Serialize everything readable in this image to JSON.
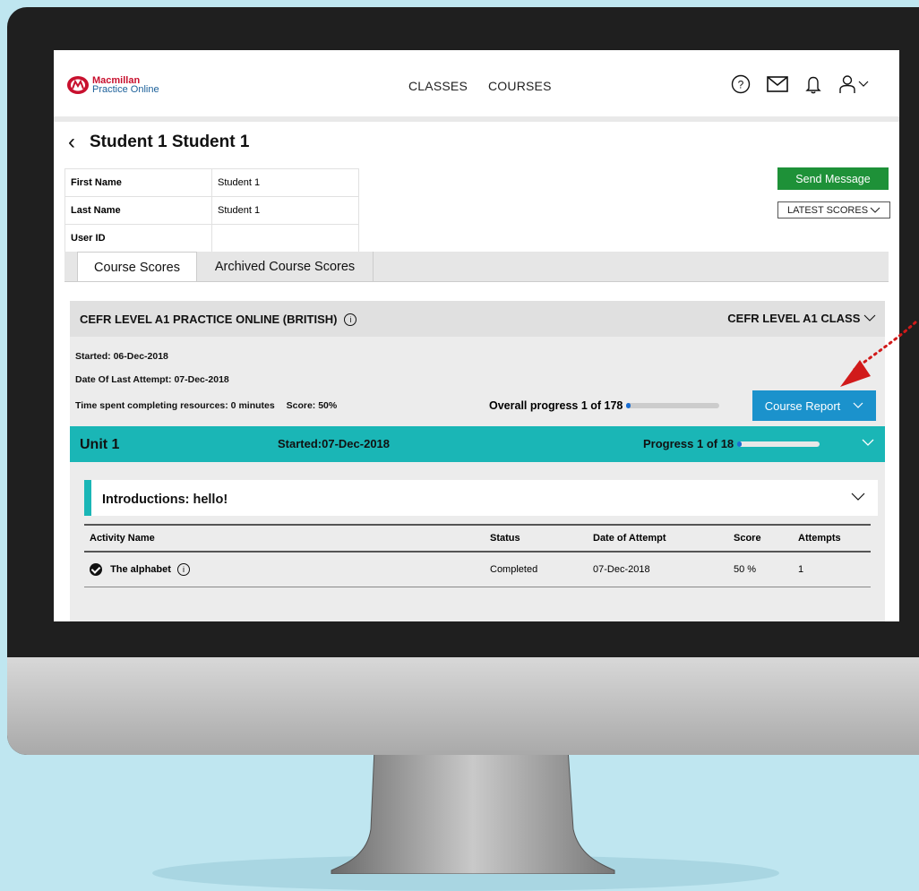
{
  "header": {
    "logo_line1": "Macmillan",
    "logo_line2": "Practice Online",
    "nav": [
      "CLASSES",
      "COURSES"
    ],
    "icons": [
      "help-icon",
      "mail-icon",
      "bell-icon",
      "user-icon",
      "chevron-down-icon"
    ]
  },
  "student": {
    "title": "Student 1 Student 1",
    "fields": [
      {
        "label": "First Name",
        "value": "Student 1"
      },
      {
        "label": "Last Name",
        "value": "Student 1"
      },
      {
        "label": "User ID",
        "value": ""
      }
    ],
    "send_message": "Send Message",
    "latest_scores": "LATEST SCORES"
  },
  "tabs": [
    "Course Scores",
    "Archived Course Scores"
  ],
  "course": {
    "name": "CEFR LEVEL A1 PRACTICE ONLINE (BRITISH)",
    "class": "CEFR LEVEL A1 CLASS",
    "started": "Started: 06-Dec-2018",
    "last_attempt": "Date Of Last Attempt: 07-Dec-2018",
    "time_spent": "Time spent completing resources: 0 minutes",
    "score": "Score: 50%",
    "overall_progress": "Overall progress 1 of 178",
    "overall_fraction": 0.006,
    "report_button": "Course Report"
  },
  "unit": {
    "name": "Unit 1",
    "started": "Started:07-Dec-2018",
    "progress": "Progress 1 of 18",
    "progress_fraction": 0.056
  },
  "lesson": {
    "title": "Introductions: hello!",
    "columns": [
      "Activity Name",
      "Status",
      "Date of Attempt",
      "Score",
      "Attempts"
    ],
    "rows": [
      {
        "name": "The alphabet",
        "status": "Completed",
        "date": "07-Dec-2018",
        "score": "50 %",
        "attempts": "1"
      }
    ]
  },
  "colors": {
    "accent_green": "#1e9138",
    "accent_blue": "#1b92cc",
    "unit_teal": "#1ab6b6",
    "annotation_red": "#d11a1a"
  }
}
